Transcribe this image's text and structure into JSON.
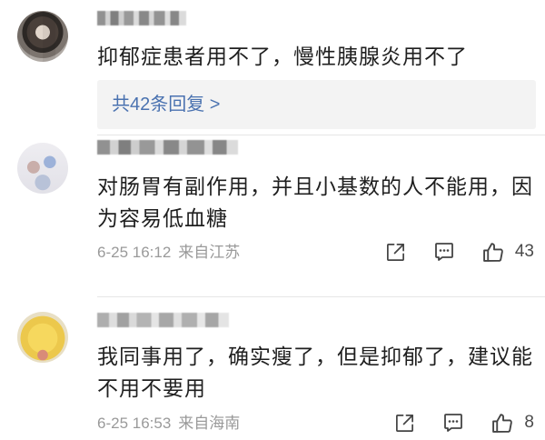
{
  "comments": [
    {
      "text": "抑郁症患者用不了，慢性胰腺炎用不了",
      "replies_label": "共42条回复 >"
    },
    {
      "text": "对肠胃有副作用，并且小基数的人不能用，因为容易低血糖",
      "time": "6-25 16:12",
      "location": "来自江苏",
      "likes": "43"
    },
    {
      "text": "我同事用了，确实瘦了，但是抑郁了，建议能不用不要用",
      "time": "6-25 16:53",
      "location": "来自海南",
      "likes": "8"
    }
  ],
  "icons": {
    "share": "share-icon",
    "comment": "comment-icon",
    "like": "thumbs-up-icon"
  },
  "colors": {
    "text": "#1f1f1f",
    "meta": "#9a9a9a",
    "link": "#4a72b0",
    "reply_background": "#f3f3f3",
    "divider": "#e6e6e6",
    "icon": "#444444"
  }
}
